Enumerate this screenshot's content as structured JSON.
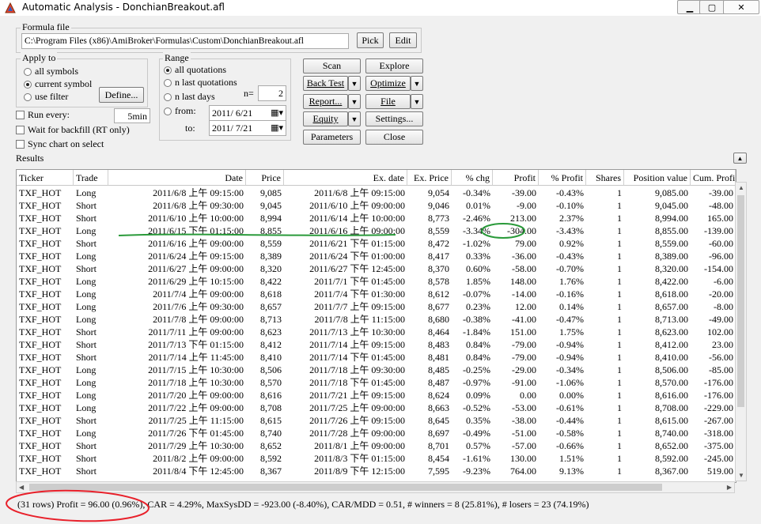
{
  "window": {
    "title": "Automatic Analysis - DonchianBreakout.afl"
  },
  "formula": {
    "group_label": "Formula file",
    "path": "C:\\Program Files (x86)\\AmiBroker\\Formulas\\Custom\\DonchianBreakout.afl",
    "pick": "Pick",
    "edit": "Edit"
  },
  "apply_to": {
    "label": "Apply to",
    "all_symbols": "all symbols",
    "current_symbol": "current symbol",
    "use_filter": "use filter",
    "define": "Define..."
  },
  "range": {
    "label": "Range",
    "all_quotations": "all quotations",
    "n_last_quotations": "n last quotations",
    "n_last_days": "n last days",
    "n_label": "n=",
    "n_value": "2",
    "from_label": "from:",
    "from_date": "2011/ 6/21",
    "to_label": "to:",
    "to_date": "2011/ 7/21"
  },
  "run_every": {
    "label": "Run every:",
    "value": "5min"
  },
  "wait_backfill": "Wait for backfill (RT only)",
  "sync_chart": "Sync chart on select",
  "buttons": {
    "scan": "Scan",
    "explore": "Explore",
    "back_test": "Back Test",
    "optimize": "Optimize",
    "report": "Report...",
    "file": "File",
    "equity": "Equity",
    "settings": "Settings...",
    "parameters": "Parameters",
    "close": "Close"
  },
  "results": {
    "label": "Results",
    "columns": [
      "Ticker",
      "Trade",
      "Date",
      "Price",
      "Ex. date",
      "Ex. Price",
      "% chg",
      "Profit",
      "% Profit",
      "Shares",
      "Position value",
      "Cum. Profit"
    ],
    "rows": [
      [
        "TXF_HOT",
        "Long",
        "2011/6/8 上午 09:15:00",
        "9,085",
        "2011/6/8 上午 09:15:00",
        "9,054",
        "-0.34%",
        "-39.00",
        "-0.43%",
        "1",
        "9,085.00",
        "-39.00"
      ],
      [
        "TXF_HOT",
        "Short",
        "2011/6/8 上午 09:30:00",
        "9,045",
        "2011/6/10 上午 09:00:00",
        "9,046",
        "0.01%",
        "-9.00",
        "-0.10%",
        "1",
        "9,045.00",
        "-48.00"
      ],
      [
        "TXF_HOT",
        "Short",
        "2011/6/10 上午 10:00:00",
        "8,994",
        "2011/6/14 上午 10:00:00",
        "8,773",
        "-2.46%",
        "213.00",
        "2.37%",
        "1",
        "8,994.00",
        "165.00"
      ],
      [
        "TXF_HOT",
        "Long",
        "2011/6/15 下午 01:15:00",
        "8,855",
        "2011/6/16 上午 09:00:00",
        "8,559",
        "-3.34%",
        "-304.00",
        "-3.43%",
        "1",
        "8,855.00",
        "-139.00"
      ],
      [
        "TXF_HOT",
        "Short",
        "2011/6/16 上午 09:00:00",
        "8,559",
        "2011/6/21 下午 01:15:00",
        "8,472",
        "-1.02%",
        "79.00",
        "0.92%",
        "1",
        "8,559.00",
        "-60.00"
      ],
      [
        "TXF_HOT",
        "Long",
        "2011/6/24 上午 09:15:00",
        "8,389",
        "2011/6/24 下午 01:00:00",
        "8,417",
        "0.33%",
        "-36.00",
        "-0.43%",
        "1",
        "8,389.00",
        "-96.00"
      ],
      [
        "TXF_HOT",
        "Short",
        "2011/6/27 上午 09:00:00",
        "8,320",
        "2011/6/27 下午 12:45:00",
        "8,370",
        "0.60%",
        "-58.00",
        "-0.70%",
        "1",
        "8,320.00",
        "-154.00"
      ],
      [
        "TXF_HOT",
        "Long",
        "2011/6/29 上午 10:15:00",
        "8,422",
        "2011/7/1 下午 01:45:00",
        "8,578",
        "1.85%",
        "148.00",
        "1.76%",
        "1",
        "8,422.00",
        "-6.00"
      ],
      [
        "TXF_HOT",
        "Long",
        "2011/7/4 上午 09:00:00",
        "8,618",
        "2011/7/4 下午 01:30:00",
        "8,612",
        "-0.07%",
        "-14.00",
        "-0.16%",
        "1",
        "8,618.00",
        "-20.00"
      ],
      [
        "TXF_HOT",
        "Long",
        "2011/7/6 上午 09:30:00",
        "8,657",
        "2011/7/7 上午 09:15:00",
        "8,677",
        "0.23%",
        "12.00",
        "0.14%",
        "1",
        "8,657.00",
        "-8.00"
      ],
      [
        "TXF_HOT",
        "Long",
        "2011/7/8 上午 09:00:00",
        "8,713",
        "2011/7/8 上午 11:15:00",
        "8,680",
        "-0.38%",
        "-41.00",
        "-0.47%",
        "1",
        "8,713.00",
        "-49.00"
      ],
      [
        "TXF_HOT",
        "Short",
        "2011/7/11 上午 09:00:00",
        "8,623",
        "2011/7/13 上午 10:30:00",
        "8,464",
        "-1.84%",
        "151.00",
        "1.75%",
        "1",
        "8,623.00",
        "102.00"
      ],
      [
        "TXF_HOT",
        "Short",
        "2011/7/13 下午 01:15:00",
        "8,412",
        "2011/7/14 上午 09:15:00",
        "8,483",
        "0.84%",
        "-79.00",
        "-0.94%",
        "1",
        "8,412.00",
        "23.00"
      ],
      [
        "TXF_HOT",
        "Short",
        "2011/7/14 上午 11:45:00",
        "8,410",
        "2011/7/14 下午 01:45:00",
        "8,481",
        "0.84%",
        "-79.00",
        "-0.94%",
        "1",
        "8,410.00",
        "-56.00"
      ],
      [
        "TXF_HOT",
        "Long",
        "2011/7/15 上午 10:30:00",
        "8,506",
        "2011/7/18 上午 09:30:00",
        "8,485",
        "-0.25%",
        "-29.00",
        "-0.34%",
        "1",
        "8,506.00",
        "-85.00"
      ],
      [
        "TXF_HOT",
        "Long",
        "2011/7/18 上午 10:30:00",
        "8,570",
        "2011/7/18 下午 01:45:00",
        "8,487",
        "-0.97%",
        "-91.00",
        "-1.06%",
        "1",
        "8,570.00",
        "-176.00"
      ],
      [
        "TXF_HOT",
        "Long",
        "2011/7/20 上午 09:00:00",
        "8,616",
        "2011/7/21 上午 09:15:00",
        "8,624",
        "0.09%",
        "0.00",
        "0.00%",
        "1",
        "8,616.00",
        "-176.00"
      ],
      [
        "TXF_HOT",
        "Long",
        "2011/7/22 上午 09:00:00",
        "8,708",
        "2011/7/25 上午 09:00:00",
        "8,663",
        "-0.52%",
        "-53.00",
        "-0.61%",
        "1",
        "8,708.00",
        "-229.00"
      ],
      [
        "TXF_HOT",
        "Short",
        "2011/7/25 上午 11:15:00",
        "8,615",
        "2011/7/26 上午 09:15:00",
        "8,645",
        "0.35%",
        "-38.00",
        "-0.44%",
        "1",
        "8,615.00",
        "-267.00"
      ],
      [
        "TXF_HOT",
        "Long",
        "2011/7/26 下午 01:45:00",
        "8,740",
        "2011/7/28 上午 09:00:00",
        "8,697",
        "-0.49%",
        "-51.00",
        "-0.58%",
        "1",
        "8,740.00",
        "-318.00"
      ],
      [
        "TXF_HOT",
        "Short",
        "2011/7/29 上午 10:30:00",
        "8,652",
        "2011/8/1 上午 09:00:00",
        "8,701",
        "0.57%",
        "-57.00",
        "-0.66%",
        "1",
        "8,652.00",
        "-375.00"
      ],
      [
        "TXF_HOT",
        "Short",
        "2011/8/2 上午 09:00:00",
        "8,592",
        "2011/8/3 下午 01:15:00",
        "8,454",
        "-1.61%",
        "130.00",
        "1.51%",
        "1",
        "8,592.00",
        "-245.00"
      ],
      [
        "TXF_HOT",
        "Short",
        "2011/8/4 下午 12:45:00",
        "8,367",
        "2011/8/9 下午 12:15:00",
        "7,595",
        "-9.23%",
        "764.00",
        "9.13%",
        "1",
        "8,367.00",
        "519.00"
      ]
    ]
  },
  "status": {
    "text": "(31 rows) Profit = 96.00 (0.96%), CAR = 4.29%, MaxSysDD = -923.00 (-8.40%), CAR/MDD = 0.51, # winners = 8 (25.81%), # losers = 23 (74.19%)"
  },
  "annotation_color": "#e8202a",
  "highlight_color": "#2a9a3a"
}
